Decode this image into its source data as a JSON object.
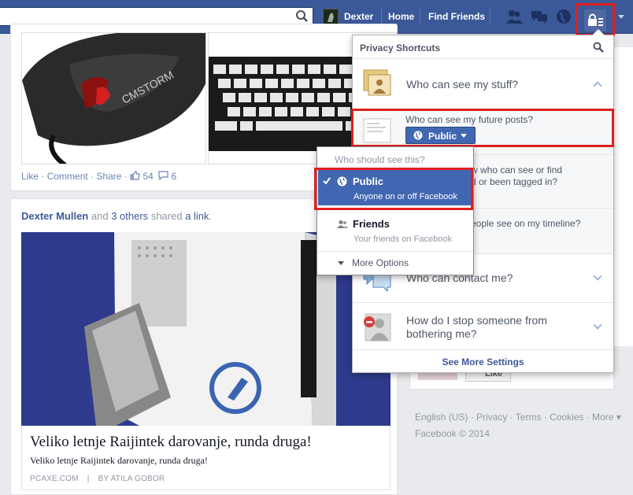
{
  "topbar": {
    "search_placeholder": "",
    "user_name": "Dexter",
    "home": "Home",
    "find_friends": "Find Friends"
  },
  "feed": {
    "post1_actions": {
      "like": "Like",
      "comment": "Comment",
      "share": "Share",
      "likes_count": "54",
      "comments_count": "6"
    },
    "post2": {
      "actor": "Dexter Mullen",
      "and": "and",
      "others": "3 others",
      "shared": "shared",
      "link": "a link",
      "article_title": "Veliko letnje Raijintek darovanje, runda druga!",
      "article_desc": "Veliko letnje Raijintek darovanje, runda druga!",
      "source": "PCAXE.COM",
      "author": "BY ATILA GOBOR"
    }
  },
  "privacy_panel": {
    "title": "Privacy Shortcuts",
    "sections": [
      {
        "label": "Who can see my stuff?"
      },
      {
        "label": "Who can contact me?"
      },
      {
        "label": "How do I stop someone from bothering me?"
      }
    ],
    "future_posts_question": "Who can see my future posts?",
    "audience_button": "Public",
    "hidden_text_1": "w who can see or find",
    "hidden_text_2": "d or been tagged in?",
    "hidden_text_3": "eople see on my timeline?",
    "see_more": "See More Settings"
  },
  "audience_menu": {
    "header": "Who should see this?",
    "options": [
      {
        "title": "Public",
        "subtitle": "Anyone on or off Facebook",
        "selected": true
      },
      {
        "title": "Friends",
        "subtitle": "Your friends on Facebook",
        "selected": false
      }
    ],
    "more_options": "More Options"
  },
  "right_col": {
    "like_button": "Like"
  },
  "footer": {
    "line1": "English (US) · Privacy · Terms · Cookies · More ▾",
    "line2": "Facebook © 2014"
  },
  "colors": {
    "brand_blue": "#3b5998",
    "highlight_red": "#e02020",
    "button_blue": "#4267b2"
  }
}
